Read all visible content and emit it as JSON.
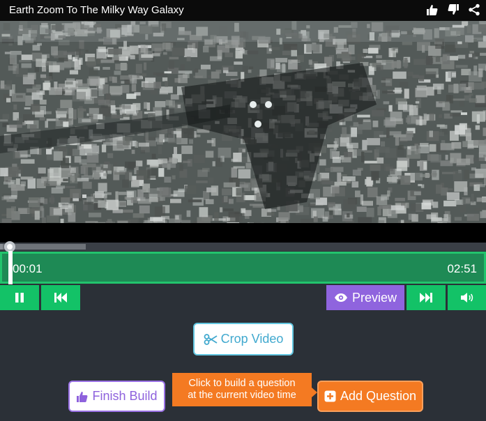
{
  "header": {
    "title": "Earth Zoom To The Milky Way Galaxy",
    "icons": [
      "thumbs-up-icon",
      "thumbs-down-icon",
      "share-icon"
    ]
  },
  "video": {
    "scene": "aerial-city-view"
  },
  "progress": {
    "played_fraction": 0.006,
    "buffered_fraction": 0.176
  },
  "timeline": {
    "current_time": "00:01",
    "total_time": "02:51"
  },
  "controls": {
    "pause_icon": "pause-icon",
    "rewind_icon": "step-backward-icon",
    "preview_label": "Preview",
    "preview_icon": "eye-icon",
    "forward_icon": "step-forward-icon",
    "volume_icon": "volume-icon"
  },
  "actions": {
    "crop_label": "Crop Video",
    "crop_icon": "scissors-icon",
    "finish_label": "Finish Build",
    "finish_icon": "thumbs-up-icon",
    "tooltip_line1": "Click to build a question",
    "tooltip_line2": "at the current video time",
    "add_question_label": "Add Question",
    "add_question_icon": "plus-square-icon"
  },
  "colors": {
    "background": "#2b3037",
    "green": "#13c267",
    "timeline": "#1e8a55",
    "purple": "#8f64de",
    "orange": "#f47a22",
    "crop_blue": "#41a9cf"
  }
}
